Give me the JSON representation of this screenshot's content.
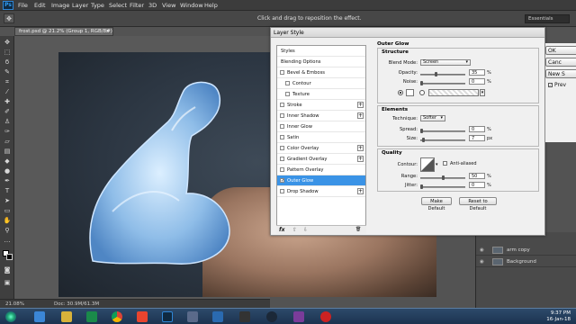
{
  "app": {
    "logo": "Ps"
  },
  "menu": [
    "File",
    "Edit",
    "Image",
    "Layer",
    "Type",
    "Select",
    "Filter",
    "3D",
    "View",
    "Window",
    "Help"
  ],
  "options_bar": {
    "hint": "Click and drag to reposition the effect.",
    "workspace": "Essentials"
  },
  "document": {
    "tab": "frost.psd @ 21.2% (Group 1, RGB/8#) *",
    "close": "×"
  },
  "status": {
    "zoom": "21.08%",
    "doc": "Doc: 30.9M/61.3M"
  },
  "dialog": {
    "title": "Layer Style",
    "styles_list": [
      {
        "label": "Styles",
        "kind": "hdr"
      },
      {
        "label": "Blending Options",
        "kind": "hdr"
      },
      {
        "label": "Bevel & Emboss",
        "kind": "cb"
      },
      {
        "label": "Contour",
        "kind": "sub"
      },
      {
        "label": "Texture",
        "kind": "sub"
      },
      {
        "label": "Stroke",
        "kind": "cb",
        "plus": "+"
      },
      {
        "label": "Inner Shadow",
        "kind": "cb",
        "plus": "+"
      },
      {
        "label": "Inner Glow",
        "kind": "cb"
      },
      {
        "label": "Satin",
        "kind": "cb"
      },
      {
        "label": "Color Overlay",
        "kind": "cb",
        "plus": "+"
      },
      {
        "label": "Gradient Overlay",
        "kind": "cb",
        "plus": "+"
      },
      {
        "label": "Pattern Overlay",
        "kind": "cb"
      },
      {
        "label": "Outer Glow",
        "kind": "cb",
        "selected": true,
        "checked": true
      },
      {
        "label": "Drop Shadow",
        "kind": "cb",
        "plus": "+"
      }
    ],
    "fx_bar": {
      "fx": "fx",
      "up": "⇧",
      "down": "⇩",
      "trash": "🗑"
    },
    "outer_glow": {
      "title": "Outer Glow",
      "structure": {
        "title": "Structure",
        "blend_mode_label": "Blend Mode:",
        "blend_mode": "Screen",
        "opacity_label": "Opacity:",
        "opacity": "35",
        "noise_label": "Noise:",
        "noise": "0",
        "percent": "%",
        "opacity_fraction": 0.35,
        "noise_fraction": 0
      },
      "elements": {
        "title": "Elements",
        "technique_label": "Technique:",
        "technique": "Softer",
        "spread_label": "Spread:",
        "spread": "0",
        "size_label": "Size:",
        "size": "7",
        "px": "px",
        "spread_fraction": 0,
        "size_fraction": 0.05
      },
      "quality": {
        "title": "Quality",
        "contour_label": "Contour:",
        "antialiased": "Anti-aliased",
        "range_label": "Range:",
        "range": "50",
        "jitter_label": "Jitter:",
        "jitter": "0",
        "range_fraction": 0.5,
        "jitter_fraction": 0
      },
      "make_default": "Make Default",
      "reset_default": "Reset to Default"
    },
    "side_buttons": {
      "ok": "OK",
      "cancel": "Canc",
      "new_style": "New S",
      "preview": "Prev"
    }
  },
  "layers": [
    {
      "name": "arm copy"
    },
    {
      "name": "Background"
    }
  ],
  "clock": {
    "time": "9:37 PM",
    "date": "16-Jan-18"
  },
  "colors": {
    "selection": "#3a93e6",
    "ice": "#9cc7ee"
  }
}
